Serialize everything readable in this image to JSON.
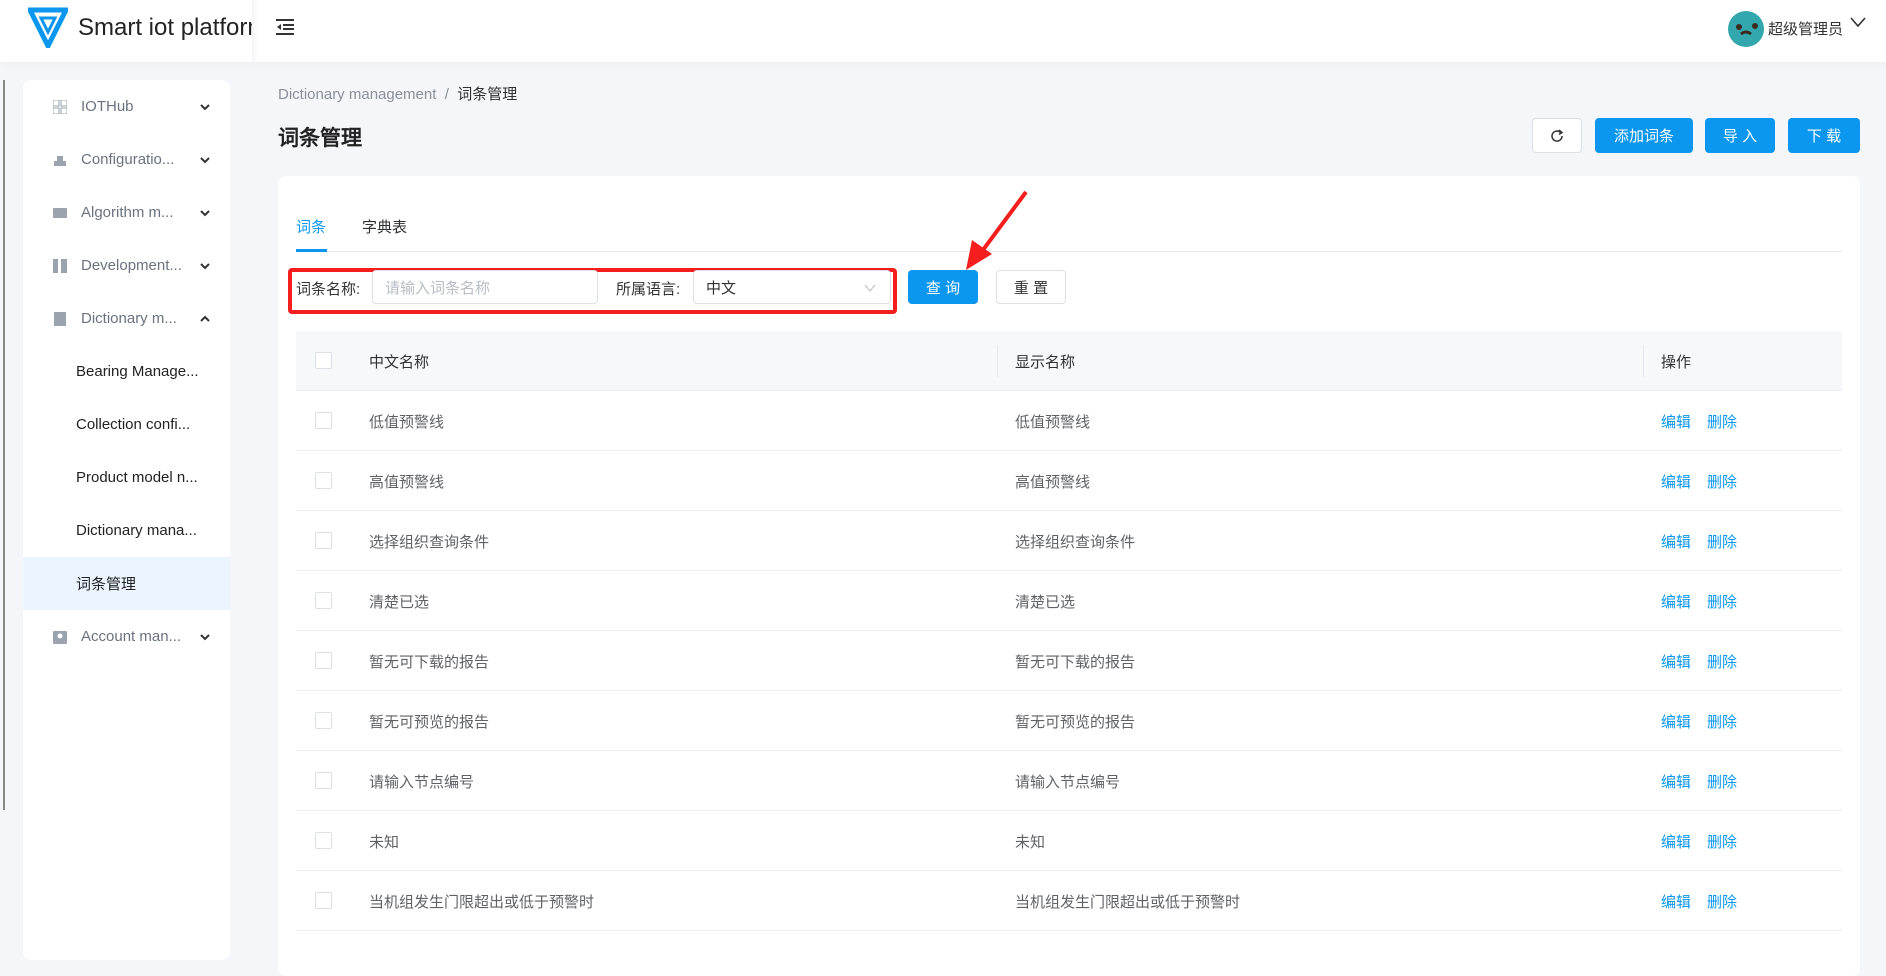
{
  "header": {
    "app_title": "Smart iot platform",
    "user_name": "超级管理员"
  },
  "sidebar": {
    "items": [
      {
        "label": "IOTHub",
        "icon": "grid-icon",
        "expanded": false
      },
      {
        "label": "Configuratio...",
        "icon": "config-icon",
        "expanded": false
      },
      {
        "label": "Algorithm m...",
        "icon": "code-icon",
        "expanded": false
      },
      {
        "label": "Development...",
        "icon": "dev-icon",
        "expanded": false
      },
      {
        "label": "Dictionary m...",
        "icon": "book-icon",
        "expanded": true
      },
      {
        "label": "Bearing Manage..."
      },
      {
        "label": "Collection confi..."
      },
      {
        "label": "Product model n..."
      },
      {
        "label": "Dictionary mana..."
      },
      {
        "label": "词条管理",
        "active": true
      },
      {
        "label": "Account man...",
        "icon": "account-icon",
        "expanded": false
      }
    ]
  },
  "breadcrumb": {
    "parent": "Dictionary management",
    "sep": "/",
    "current": "词条管理"
  },
  "page_title": "词条管理",
  "toolbar": {
    "add": "添加词条",
    "import": "导 入",
    "download": "下 载"
  },
  "tabs": [
    {
      "label": "词条",
      "active": true
    },
    {
      "label": "字典表"
    }
  ],
  "filter": {
    "name_label": "词条名称:",
    "name_placeholder": "请输入词条名称",
    "name_value": "",
    "lang_label": "所属语言:",
    "lang_value": "中文",
    "query": "查 询",
    "reset": "重 置"
  },
  "table": {
    "headers": [
      "中文名称",
      "显示名称",
      "操作"
    ],
    "edit": "编辑",
    "delete": "删除",
    "rows": [
      [
        "低值预警线",
        "低值预警线"
      ],
      [
        "高值预警线",
        "高值预警线"
      ],
      [
        "选择组织查询条件",
        "选择组织查询条件"
      ],
      [
        "清楚已选",
        "清楚已选"
      ],
      [
        "暂无可下载的报告",
        "暂无可下载的报告"
      ],
      [
        "暂无可预览的报告",
        "暂无可预览的报告"
      ],
      [
        "请输入节点编号",
        "请输入节点编号"
      ],
      [
        "未知",
        "未知"
      ],
      [
        "当机组发生门限超出或低于预警时",
        "当机组发生门限超出或低于预警时"
      ]
    ]
  },
  "colors": {
    "primary": "#0b96ef",
    "highlight": "#f51d1d"
  }
}
